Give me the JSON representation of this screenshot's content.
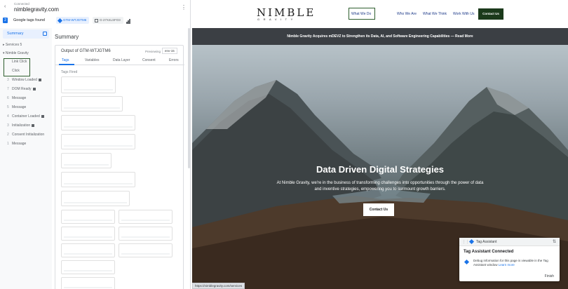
{
  "tag_assistant": {
    "header": {
      "status": "Connected",
      "domain": "nimblegravity.com"
    },
    "tabs": {
      "count": "2",
      "found_label": "Google tags found",
      "gtm_chip": "GTM-WTJGTM6",
      "ga_chip": "G-27X4LSFO3"
    },
    "sidebar": {
      "summary": "Summary",
      "services": "Services",
      "services_count": "5",
      "page": "Nimble Gravity",
      "events": [
        {
          "num": "",
          "label": "Link Click"
        },
        {
          "num": "",
          "label": "Click"
        },
        {
          "num": "3",
          "label": "Window Loaded"
        },
        {
          "num": "7",
          "label": "DOM Ready"
        },
        {
          "num": "6",
          "label": "Message"
        },
        {
          "num": "5",
          "label": "Message"
        },
        {
          "num": "4",
          "label": "Container Loaded"
        },
        {
          "num": "3",
          "label": "Initialization"
        },
        {
          "num": "2",
          "label": "Consent Initialization"
        },
        {
          "num": "1",
          "label": "Message"
        }
      ]
    },
    "main": {
      "title": "Summary",
      "output_title": "Output of GTM-WTJGTM6",
      "previewing_label": "Previewing",
      "env_value": "env-15",
      "tabs": [
        "Tags",
        "Variables",
        "Data Layer",
        "Consent",
        "Errors"
      ],
      "tags_fired": "Tags Fired"
    }
  },
  "site": {
    "logo_top": "NIMBLE",
    "logo_bottom": "GRAVITY",
    "nav": [
      "What We Do",
      "Who We Are",
      "What We Think",
      "Work With Us"
    ],
    "nav_cta": "Contact Us",
    "banner": "Nimble Gravity Acquires mDEVZ to Strengthen its Data, AI, and Software Engineering Capabilities — Read More",
    "hero_title": "Data Driven Digital Strategies",
    "hero_sub": "At Nimble Gravity, we're in the business of transforming challenges into opportunities through the power of data and inventive strategies, empowering you to surmount growth barriers.",
    "hero_btn": "Contact Us",
    "status_url": "https://nimblegravity.com/services"
  },
  "popup": {
    "title": "Tag Assistant",
    "connected": "Tag Assistant Connected",
    "info": "Debug information for this page is viewable in the Tag Assistant window",
    "learn_more": "Learn more",
    "finish": "Finish"
  },
  "colors": {
    "accent": "#1a73e8",
    "brand_dark": "#1b3a1b",
    "highlight_box": "#2e5e2e",
    "banner_bg": "#3b3f44"
  }
}
